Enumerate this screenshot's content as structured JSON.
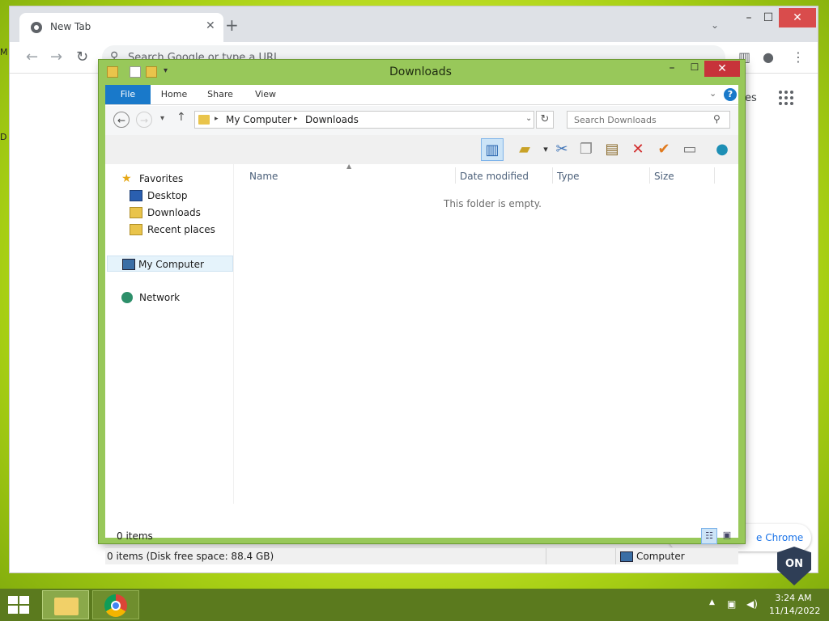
{
  "desktop": {
    "edge_letters": [
      "M",
      "D"
    ]
  },
  "chrome": {
    "tab_title": "New Tab",
    "new_tab_symbol": "+",
    "omnibox_placeholder": "Search Google or type a URL",
    "ntp_partial_text": "es",
    "customize_partial_text": "e Chrome"
  },
  "explorer": {
    "title": "Downloads",
    "ribbon_tabs": [
      "File",
      "Home",
      "Share",
      "View"
    ],
    "breadcrumb": [
      "My Computer",
      "Downloads"
    ],
    "search_placeholder": "Search Downloads",
    "nav": {
      "favorites": "Favorites",
      "desktop": "Desktop",
      "downloads": "Downloads",
      "recent": "Recent places",
      "computer": "My Computer",
      "network": "Network"
    },
    "columns": [
      "Name",
      "Date modified",
      "Type",
      "Size"
    ],
    "empty_message": "This folder is empty.",
    "item_count": "0 items",
    "status_left": "0 items (Disk free space: 88.4 GB)",
    "status_right": "Computer"
  },
  "taskbar": {
    "time": "3:24 AM",
    "date": "11/14/2022"
  },
  "badge": {
    "text": "ON"
  },
  "colors": {
    "accent": "#1979ca",
    "explorer_frame": "#98c85a",
    "close_red": "#c7333a",
    "taskbar": "#5b7a1e"
  }
}
